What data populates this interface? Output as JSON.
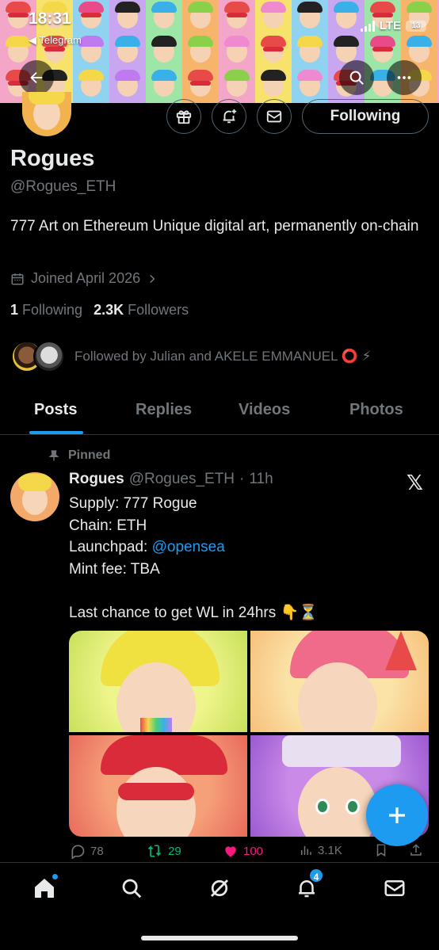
{
  "status_bar": {
    "time": "18:31",
    "back_app": "Telegram",
    "network": "LTE",
    "battery": "13"
  },
  "header_actions": {
    "back": "back",
    "search": "search",
    "more": "more"
  },
  "profile": {
    "follow_button_label": "Following",
    "name": "Rogues",
    "handle": "@Rogues_ETH",
    "bio": "777 Art on Ethereum Unique digital art, permanently on-chain",
    "joined": "Joined April 2026",
    "following_count": "1",
    "following_label": "Following",
    "followers_count": "2.3K",
    "followers_label": "Followers",
    "followed_by": "Followed by Julian and AKELE EMMANUEL ⭕️ ⚡"
  },
  "tabs": [
    "Posts",
    "Replies",
    "Videos",
    "Photos"
  ],
  "post": {
    "pinned_label": "Pinned",
    "author_name": "Rogues",
    "author_handle": "@Rogues_ETH",
    "separator": "·",
    "time": "11h",
    "lines": {
      "supply": "Supply: 777 Rogue",
      "chain": "Chain: ETH",
      "launchpad_prefix": "Launchpad: ",
      "launchpad_mention": "@opensea",
      "mint_fee": "Mint fee: TBA",
      "cta": "Last chance to get WL in 24hrs 👇⏳"
    },
    "stats": {
      "replies": "78",
      "reposts": "29",
      "likes": "100",
      "views": "3.1K"
    }
  },
  "bottom_nav": {
    "notifications_badge": "4"
  },
  "colors": {
    "accent": "#1d9bf0",
    "repost": "#00ba7c",
    "like": "#f91880",
    "muted": "#71767b"
  }
}
